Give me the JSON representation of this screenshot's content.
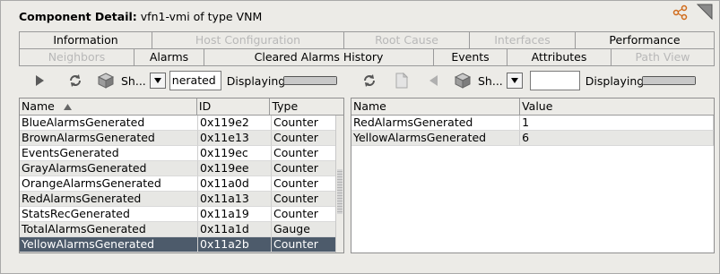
{
  "header": {
    "label": "Component Detail:",
    "value": "vfn1-vmi of type VNM"
  },
  "tabs_row1": [
    "Information",
    "Host Configuration",
    "Root Cause",
    "Interfaces",
    "Performance"
  ],
  "tabs_row2": [
    "Neighbors",
    "Alarms",
    "Cleared Alarms History",
    "Events",
    "Attributes",
    "Path View"
  ],
  "left_toolbar": {
    "show_label": "Sh...",
    "filter_value": "nerated",
    "displaying_label": "Displaying"
  },
  "right_toolbar": {
    "show_label": "Sh...",
    "filter_value": "",
    "displaying_label": "Displaying"
  },
  "left_table": {
    "columns": [
      "Name",
      "ID",
      "Type"
    ],
    "rows": [
      [
        "BlueAlarmsGenerated",
        "0x119e2",
        "Counter"
      ],
      [
        "BrownAlarmsGenerated",
        "0x11e13",
        "Counter"
      ],
      [
        "EventsGenerated",
        "0x119ec",
        "Counter"
      ],
      [
        "GrayAlarmsGenerated",
        "0x119ee",
        "Counter"
      ],
      [
        "OrangeAlarmsGenerated",
        "0x11a0d",
        "Counter"
      ],
      [
        "RedAlarmsGenerated",
        "0x11a13",
        "Counter"
      ],
      [
        "StatsRecGenerated",
        "0x11a19",
        "Counter"
      ],
      [
        "TotalAlarmsGenerated",
        "0x11a1d",
        "Gauge"
      ],
      [
        "YellowAlarmsGenerated",
        "0x11a2b",
        "Counter"
      ]
    ],
    "selected_row": 8
  },
  "right_table": {
    "columns": [
      "Name",
      "Value"
    ],
    "rows": [
      [
        "RedAlarmsGenerated",
        "1"
      ],
      [
        "YellowAlarmsGenerated",
        "6"
      ]
    ]
  },
  "colors": {
    "selection": "#4d5b6b",
    "panel": "#ecebe7",
    "alt_row": "#e7e7e4"
  }
}
